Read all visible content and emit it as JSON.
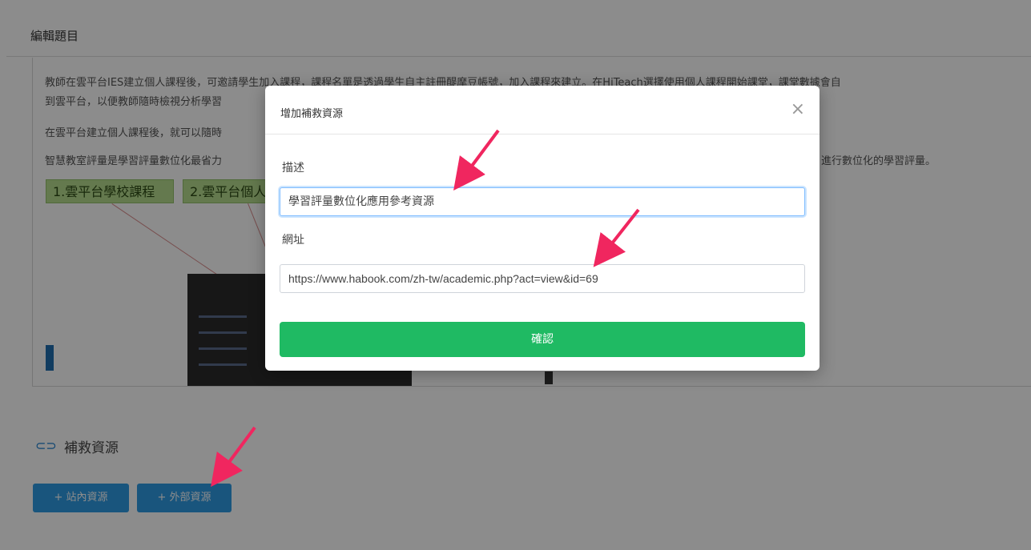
{
  "header": {
    "title": "編輯題目"
  },
  "content": {
    "paragraph1": "教師在雲平台IES建立個人課程後，可邀請學生加入課程，課程名單是透過學生自主註冊醍摩豆帳號，加入課程來建立。在HiTeach選擇使用個人課程開始課堂，課堂數據會自",
    "paragraph1b": "到雲平台，以便教師隨時檢視分析學習",
    "paragraph2": "在雲平台建立個人課程後，就可以隨時",
    "paragraph3": "智慧教室評量是學習評量數位化最省力",
    "paragraph3b": "進行數位化的學習評量。",
    "tag1": "1.雲平台學校課程",
    "tag2": "2.雲平台個人"
  },
  "remedial": {
    "title": "補救資源",
    "internal_button": "+ 站內資源",
    "external_button": "+ 外部資源"
  },
  "modal": {
    "title": "增加補救資源",
    "close_glyph": "×",
    "description_label": "描述",
    "description_value": "學習評量數位化應用參考資源",
    "url_label": "網址",
    "url_value": "https://www.habook.com/zh-tw/academic.php?act=view&id=69",
    "confirm_button": "確認"
  },
  "colors": {
    "confirm": "#1fba63",
    "primary_button": "#2f9be4",
    "arrow": "#f0265f"
  }
}
